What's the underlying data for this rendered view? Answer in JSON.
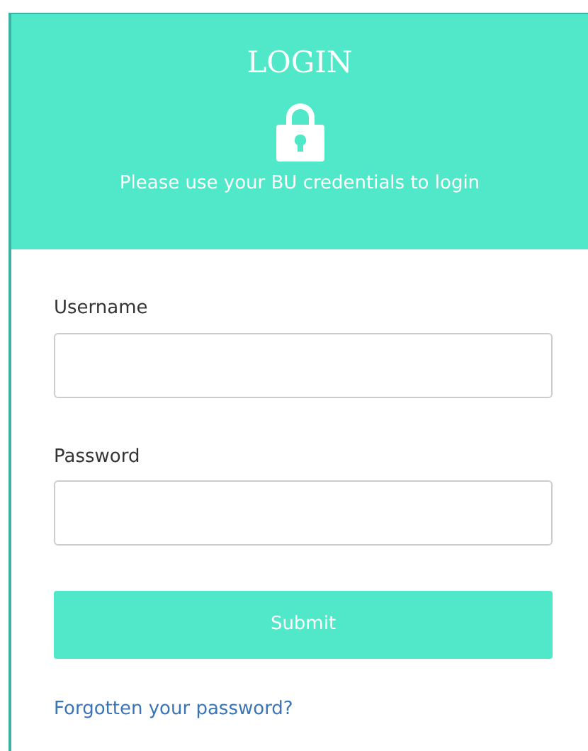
{
  "header": {
    "title": "LOGIN",
    "subtitle": "Please use your BU credentials to login"
  },
  "fields": [
    {
      "label": "Username"
    },
    {
      "label": "Password"
    }
  ],
  "submit": {
    "label": "Submit"
  },
  "link": {
    "label": "Forgotten your password?"
  }
}
